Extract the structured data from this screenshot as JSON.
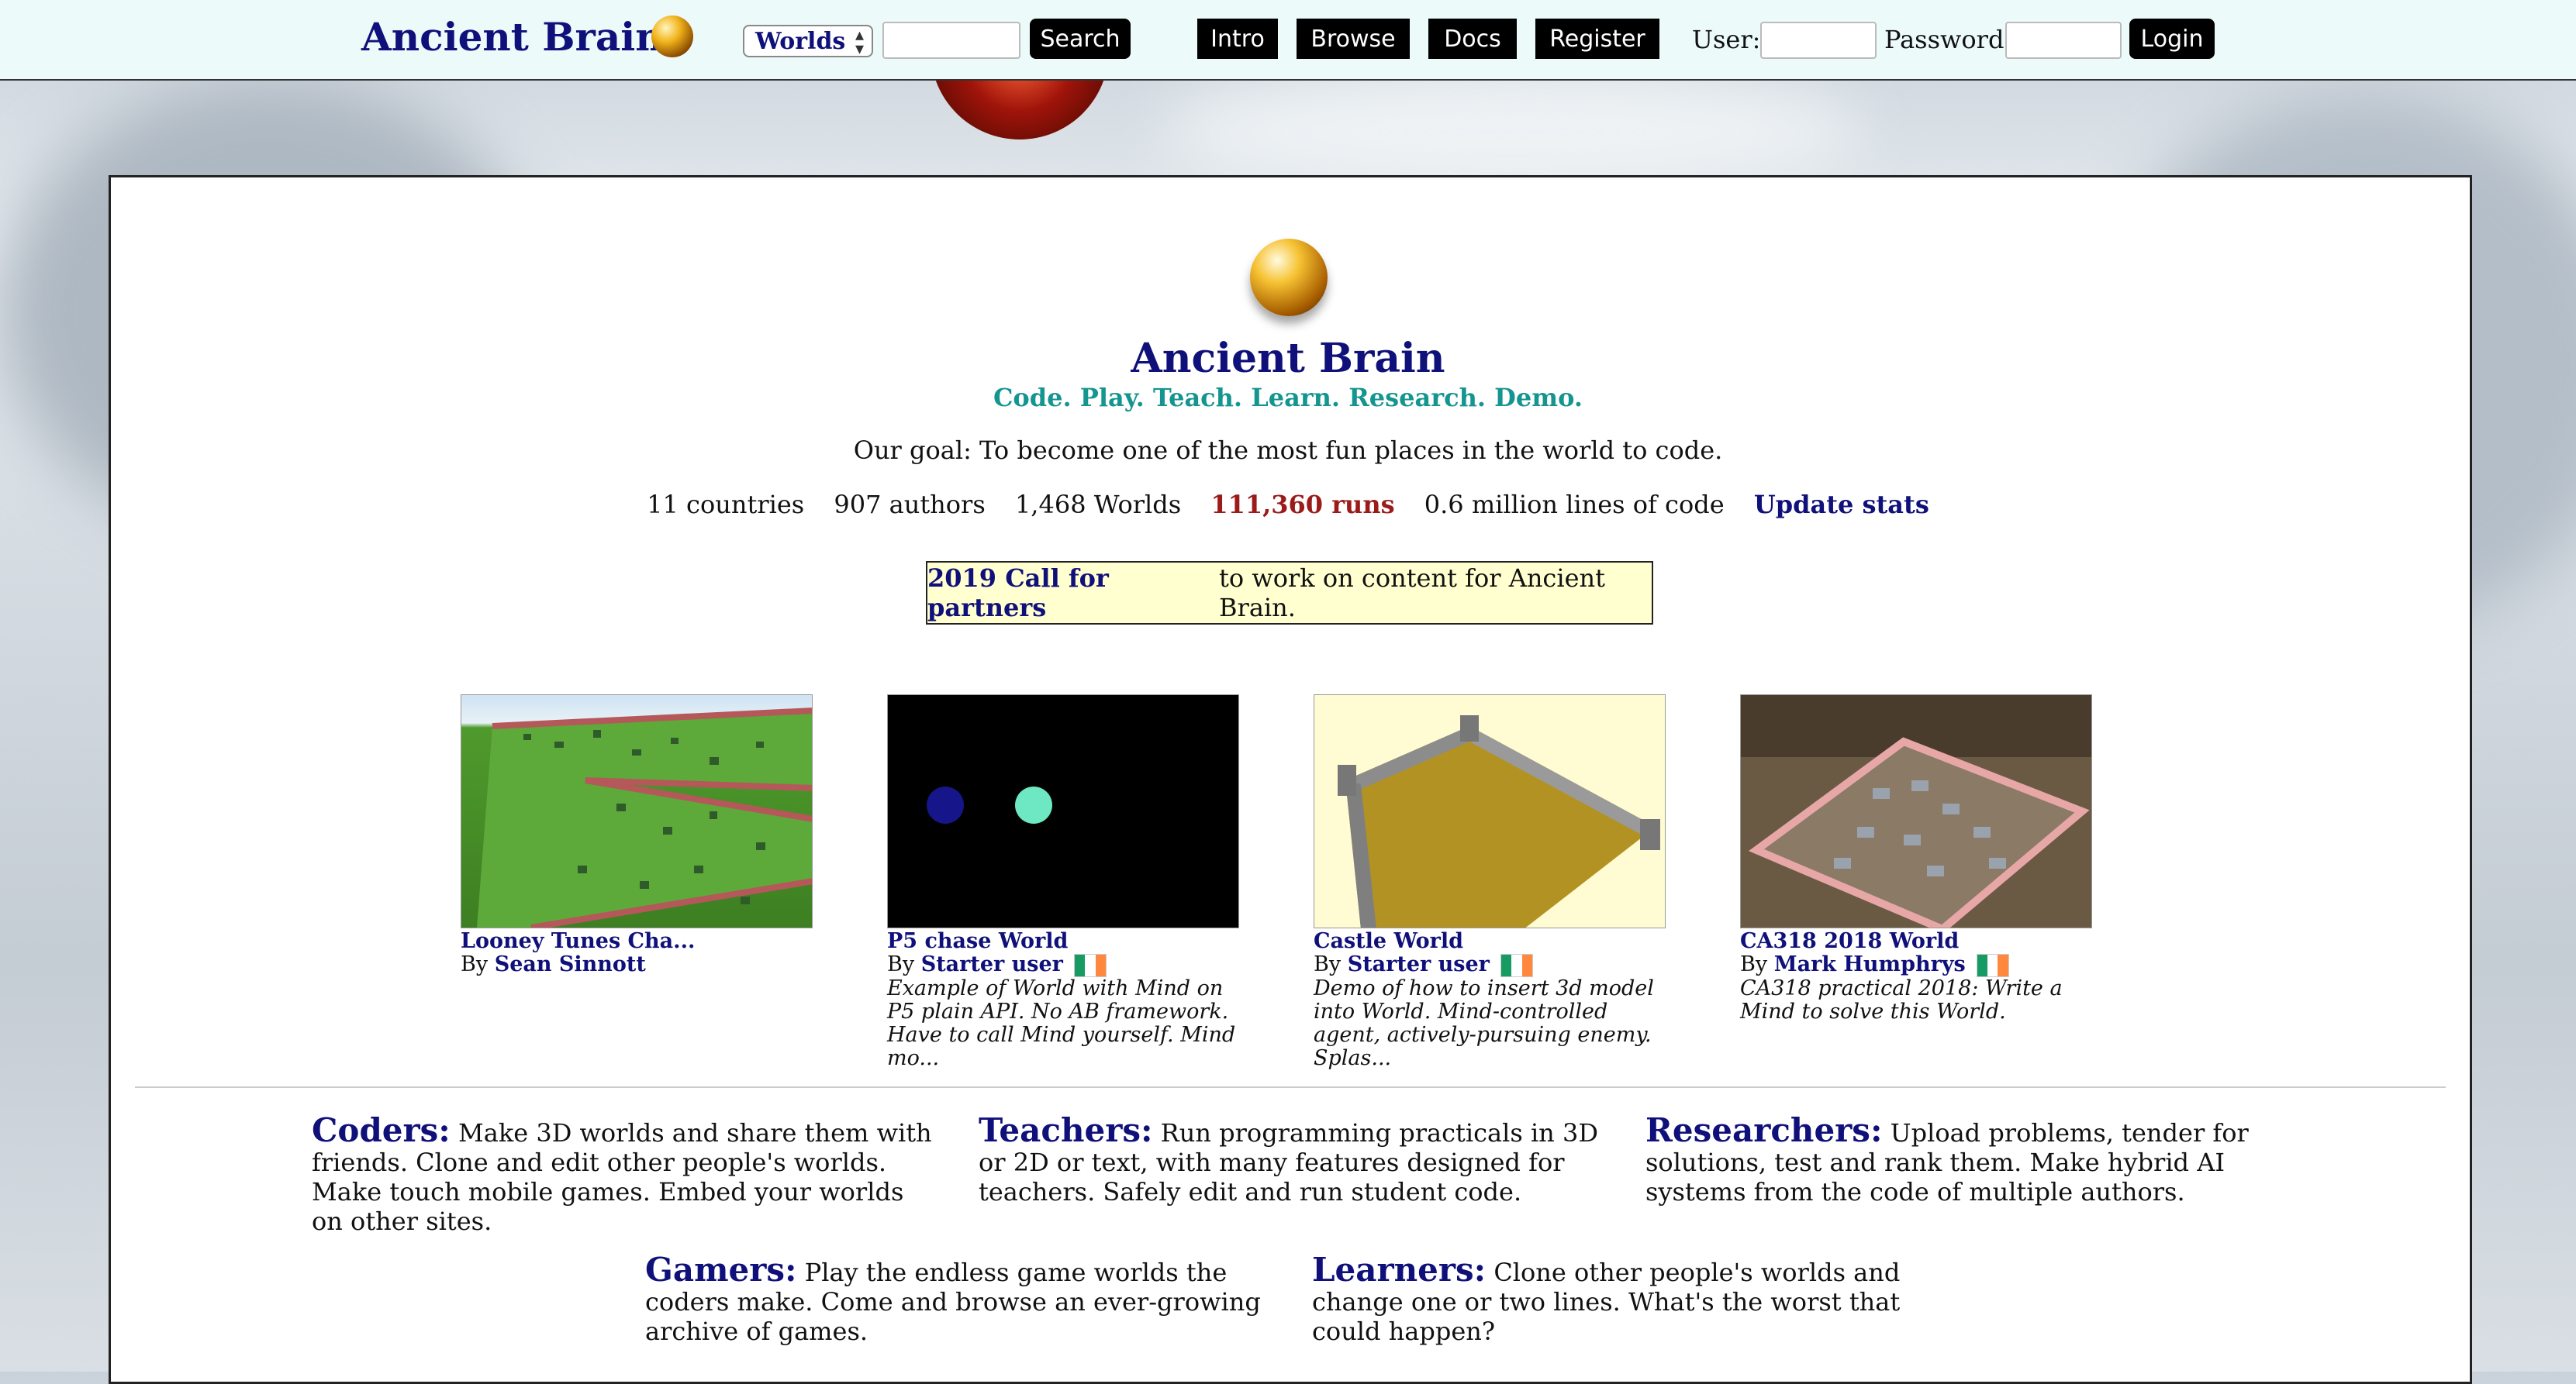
{
  "header": {
    "brand": "Ancient Brain",
    "worlds_select": "Worlds",
    "search_label": "Search",
    "nav": [
      "Intro",
      "Browse",
      "Docs",
      "Register"
    ],
    "user_label": "User:",
    "password_label": "Password:",
    "login_label": "Login"
  },
  "hero": {
    "title": "Ancient Brain",
    "tagline": "Code. Play. Teach. Learn. Research. Demo.",
    "goal": "Our goal: To become one of the most fun places in the world to code.",
    "stats": {
      "countries": "11 countries",
      "authors": "907 authors",
      "worlds": "1,468 Worlds",
      "runs": "111,360 runs",
      "lines": "0.6 million lines of code",
      "update": "Update stats"
    },
    "partners_link": "2019 Call for partners",
    "partners_text": "to work on content for Ancient Brain."
  },
  "worlds": [
    {
      "title": "Looney Tunes Cha...",
      "by": "By",
      "author": "Sean Sinnott",
      "flag": false,
      "desc": ""
    },
    {
      "title": "P5 chase World",
      "by": "By",
      "author": "Starter user",
      "flag": true,
      "desc": "Example of World with Mind on P5 plain API. No AB framework. Have to call Mind yourself. Mind mo..."
    },
    {
      "title": "Castle World",
      "by": "By",
      "author": "Starter user",
      "flag": true,
      "desc": "Demo of how to insert 3d model into World. Mind-controlled agent, actively-pursuing enemy. Splas..."
    },
    {
      "title": "CA318 2018 World",
      "by": "By",
      "author": "Mark Humphrys",
      "flag": true,
      "desc": "CA318 practical 2018: Write a Mind to solve this World."
    }
  ],
  "blurbs": {
    "coders": {
      "head": "Coders:",
      "text": "Make 3D worlds and share them with friends. Clone and edit other people's worlds. Make touch mobile games. Embed your worlds on other sites."
    },
    "teachers": {
      "head": "Teachers:",
      "text": "Run programming practicals in 3D or 2D or text, with many features designed for teachers. Safely edit and run student code."
    },
    "researchers": {
      "head": "Researchers:",
      "text": "Upload problems, tender for solutions, test and rank them. Make hybrid AI systems from the code of multiple authors."
    },
    "gamers": {
      "head": "Gamers:",
      "text": "Play the endless game worlds the coders make. Come and browse an ever-growing archive of games."
    },
    "learners": {
      "head": "Learners:",
      "text": "Clone other people's worlds and change one or two lines. What's the worst that could happen?"
    }
  }
}
